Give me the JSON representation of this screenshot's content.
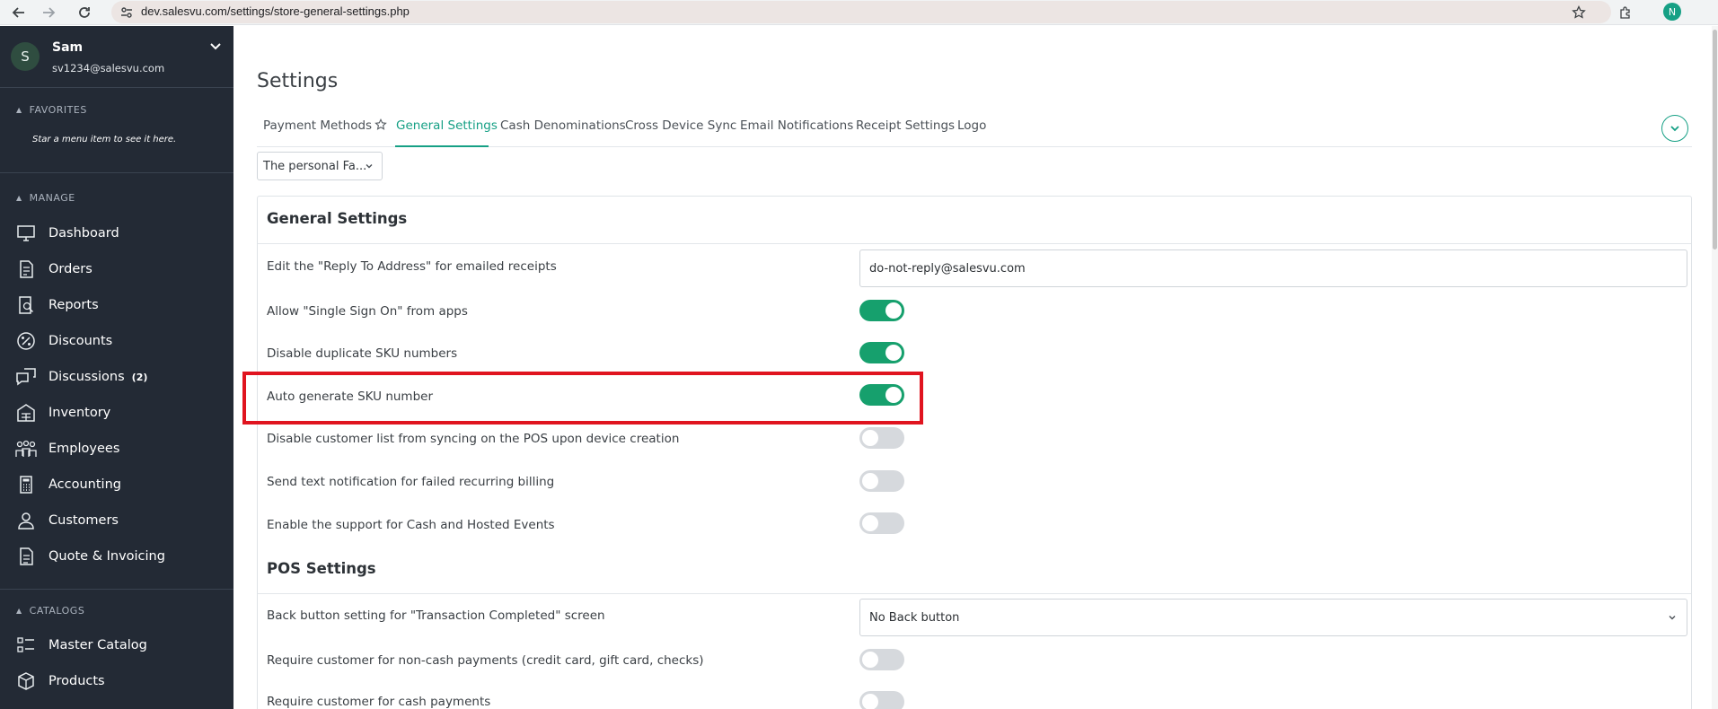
{
  "browser": {
    "url": "dev.salesvu.com/settings/store-general-settings.php",
    "profile_initial": "N"
  },
  "sidebar": {
    "user": {
      "initial": "S",
      "name": "Sam",
      "email": "sv1234@salesvu.com"
    },
    "favorites_title": "FAVORITES",
    "favorites_hint": "Star a menu item to see it here.",
    "manage_title": "MANAGE",
    "manage_items": [
      {
        "label": "Dashboard",
        "icon": "monitor-icon"
      },
      {
        "label": "Orders",
        "icon": "orders-icon"
      },
      {
        "label": "Reports",
        "icon": "reports-icon"
      },
      {
        "label": "Discounts",
        "icon": "percent-icon"
      },
      {
        "label": "Discussions",
        "icon": "chat-icon",
        "badge": "(2)"
      },
      {
        "label": "Inventory",
        "icon": "inventory-icon"
      },
      {
        "label": "Employees",
        "icon": "employees-icon"
      },
      {
        "label": "Accounting",
        "icon": "calculator-icon"
      },
      {
        "label": "Customers",
        "icon": "customer-icon"
      },
      {
        "label": "Quote & Invoicing",
        "icon": "invoice-icon"
      }
    ],
    "catalogs_title": "CATALOGS",
    "catalog_items": [
      {
        "label": "Master Catalog",
        "icon": "checklist-icon"
      },
      {
        "label": "Products",
        "icon": "box-icon"
      }
    ]
  },
  "main": {
    "title": "Settings",
    "tabs": [
      "Payment Methods",
      "General Settings",
      "Cash Denominations",
      "Cross Device Sync",
      "Email Notifications",
      "Receipt Settings",
      "Logo"
    ],
    "active_tab": "General Settings",
    "store_select": "The personal Fa...",
    "general_heading": "General Settings",
    "general_rows": [
      {
        "label": "Edit the \"Reply To Address\" for emailed receipts",
        "control": "input",
        "value": "do-not-reply@salesvu.com"
      },
      {
        "label": "Allow \"Single Sign On\" from apps",
        "control": "toggle",
        "on": true
      },
      {
        "label": "Disable duplicate SKU numbers",
        "control": "toggle",
        "on": true
      },
      {
        "label": "Auto generate SKU number",
        "control": "toggle",
        "on": true
      },
      {
        "label": "Disable customer list from syncing on the POS upon device creation",
        "control": "toggle",
        "on": false
      },
      {
        "label": "Send text notification for failed recurring billing",
        "control": "toggle",
        "on": false
      },
      {
        "label": "Enable the support for Cash and Hosted Events",
        "control": "toggle",
        "on": false
      }
    ],
    "pos_heading": "POS Settings",
    "pos_rows": [
      {
        "label": "Back button setting for \"Transaction Completed\" screen",
        "control": "select",
        "value": "No Back button"
      },
      {
        "label": "Require customer for non-cash payments (credit card, gift card, checks)",
        "control": "toggle",
        "on": false
      },
      {
        "label": "Require customer for cash payments",
        "control": "toggle",
        "on": false
      }
    ]
  },
  "colors": {
    "accent": "#16a085",
    "toggle_on": "#16a06d",
    "toggle_off": "#d6d9dd",
    "sidebar_bg": "#232a35",
    "highlight": "#e0141f"
  }
}
